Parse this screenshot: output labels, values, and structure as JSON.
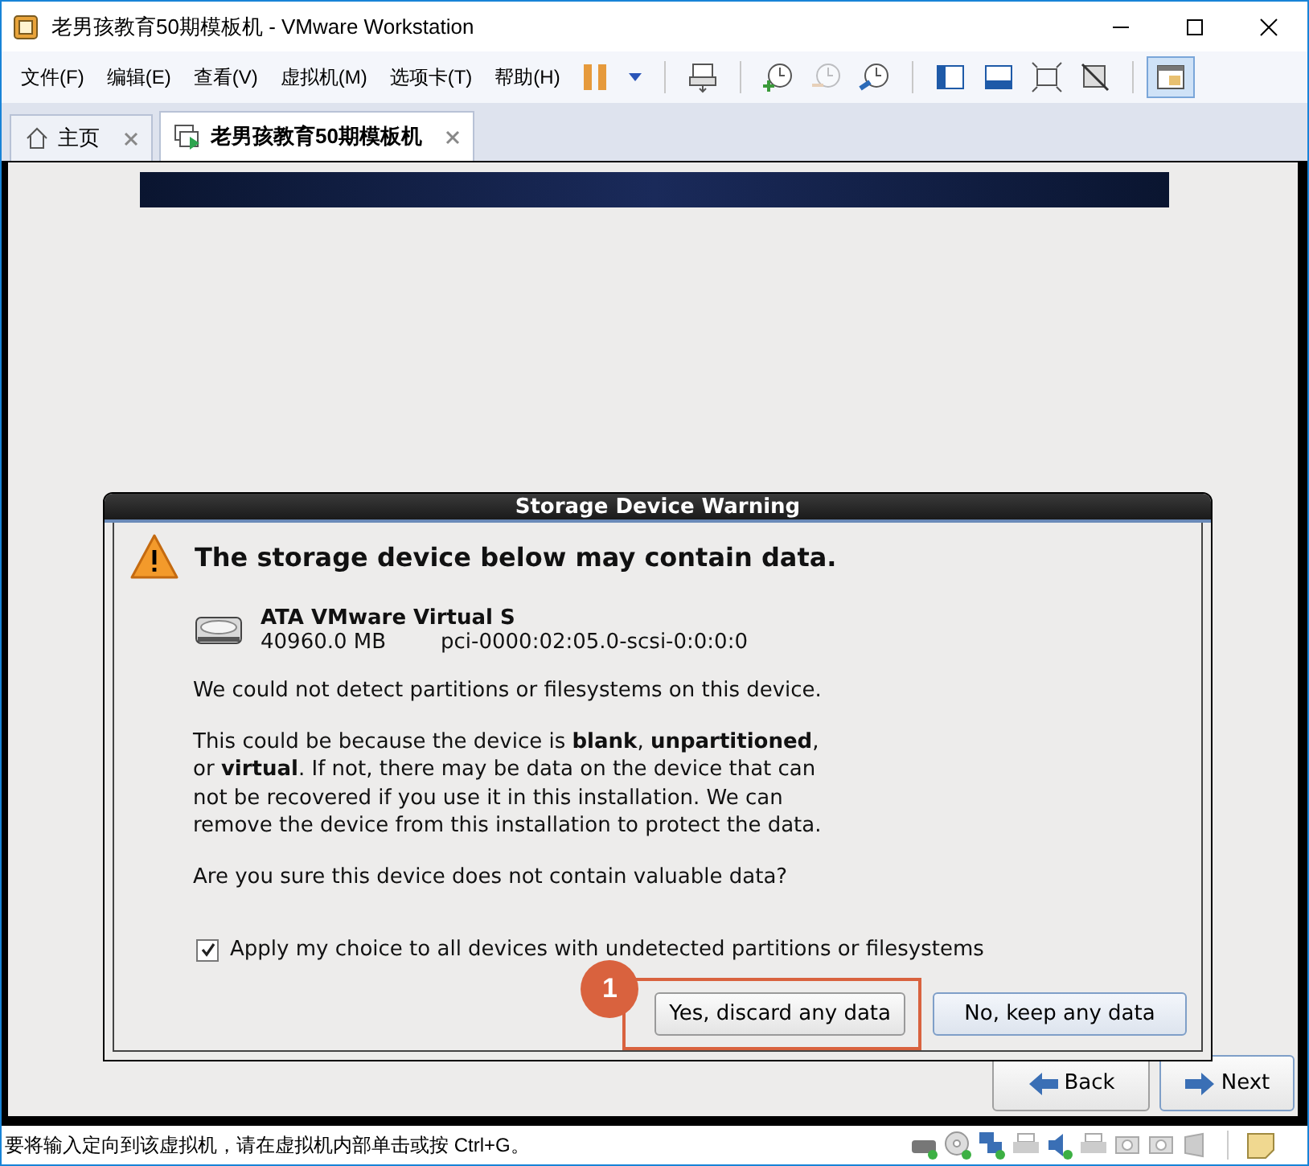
{
  "window": {
    "title": "老男孩教育50期模板机 - VMware Workstation"
  },
  "menu": [
    "文件(F)",
    "编辑(E)",
    "查看(V)",
    "虚拟机(M)",
    "选项卡(T)",
    "帮助(H)"
  ],
  "toolbar": [
    {
      "kind": "pause",
      "disabled": false,
      "selected": false
    },
    {
      "kind": "dropdown",
      "disabled": false,
      "selected": false
    },
    {
      "kind": "sep"
    },
    {
      "kind": "sendkeys",
      "disabled": false,
      "selected": false
    },
    {
      "kind": "sep"
    },
    {
      "kind": "snapshot",
      "disabled": false,
      "selected": false
    },
    {
      "kind": "revert",
      "disabled": true,
      "selected": false
    },
    {
      "kind": "manager",
      "disabled": false,
      "selected": false
    },
    {
      "kind": "sep"
    },
    {
      "kind": "sidebar",
      "disabled": false,
      "selected": false
    },
    {
      "kind": "thumbs",
      "disabled": false,
      "selected": false
    },
    {
      "kind": "fullscreen",
      "disabled": false,
      "selected": false
    },
    {
      "kind": "unity",
      "disabled": false,
      "selected": false
    },
    {
      "kind": "sep"
    },
    {
      "kind": "console",
      "disabled": false,
      "selected": true
    }
  ],
  "tabs": [
    {
      "kind": "home",
      "label": "主页",
      "selected": false
    },
    {
      "kind": "vm",
      "label": "老男孩教育50期模板机",
      "selected": true
    }
  ],
  "dialog": {
    "title": "Storage Device Warning",
    "heading": "The storage device below may contain data.",
    "device": {
      "name": "ATA VMware Virtual S",
      "size": "40960.0 MB",
      "path": "pci-0000:02:05.0-scsi-0:0:0:0"
    },
    "paragraphs": [
      "We could not detect partitions or filesystems on this device.",
      "This could be because the device is **blank**, **unpartitioned**, or **virtual**. If not, there may be data on the device that can not be recovered if you use it in this installation. We can remove the device from this installation to protect the data.",
      "Are you sure this device does not contain valuable data?"
    ],
    "checkbox": {
      "label": "Apply my choice to all devices with undetected partitions or filesystems",
      "checked": true
    },
    "buttons": [
      {
        "label": "Yes, discard any data",
        "highlighted": true,
        "marker": "1"
      },
      {
        "label": "No, keep any data",
        "highlighted": false
      }
    ]
  },
  "installer_buttons": [
    {
      "kind": "back",
      "label": "Back"
    },
    {
      "kind": "next",
      "label": "Next"
    }
  ],
  "status_bar": {
    "text": "要将输入定向到该虚拟机，请在虚拟机内部单击或按 Ctrl+G。"
  }
}
